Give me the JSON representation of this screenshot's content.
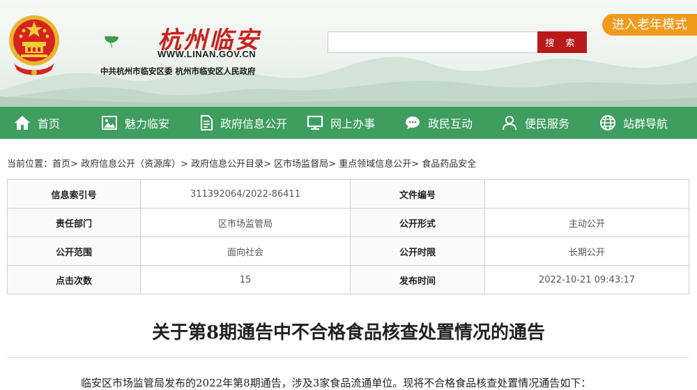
{
  "header": {
    "site_name": "杭州临安",
    "site_url": "WWW.LINAN.GOV.CN",
    "org_line": "中共杭州市临安区委  杭州市临安区人民政府",
    "search_placeholder": "",
    "search_button": "搜 索",
    "elder_mode": "进入老年模式"
  },
  "nav": {
    "items": [
      {
        "label": "首页",
        "icon": "home-icon"
      },
      {
        "label": "魅力临安",
        "icon": "picture-icon"
      },
      {
        "label": "政府信息公开",
        "icon": "document-icon"
      },
      {
        "label": "网上办事",
        "icon": "monitor-icon"
      },
      {
        "label": "政民互动",
        "icon": "chat-icon"
      },
      {
        "label": "便民服务",
        "icon": "user-icon"
      },
      {
        "label": "站群导航",
        "icon": "globe-icon"
      }
    ]
  },
  "breadcrumb": {
    "prefix": "当前位置",
    "colon": "：",
    "items": [
      "首页",
      "政府信息公开（资源库）",
      "政府信息公开目录",
      "区市场监督局",
      "重点领域信息公开",
      "食品药品安全"
    ],
    "separator": "> "
  },
  "info": {
    "rows": [
      {
        "k1": "信息索引号",
        "v1": "311392064/2022-86411",
        "k2": "文件编号",
        "v2": ""
      },
      {
        "k1": "责任部门",
        "v1": "区市场监管局",
        "k2": "公开形式",
        "v2": "主动公开"
      },
      {
        "k1": "公开范围",
        "v1": "面向社会",
        "k2": "公开时限",
        "v2": "长期公开"
      },
      {
        "k1": "点击次数",
        "v1": "15",
        "k2": "发布时间",
        "v2": "2022-10-21 09:43:17"
      }
    ]
  },
  "article": {
    "title": "关于第8期通告中不合格食品核查处置情况的通告",
    "paragraph": "临安区市场监管局发布的2022年第8期通告，涉及3家食品流通单位。现将不合格食品核查处置情况通告如下："
  },
  "colors": {
    "nav_green": "#3e9d5f",
    "search_red": "#b8191b",
    "elder_orange": "#f19a1c",
    "logo_red": "#c8231c",
    "ginkgo_green": "#3a9a3d"
  }
}
